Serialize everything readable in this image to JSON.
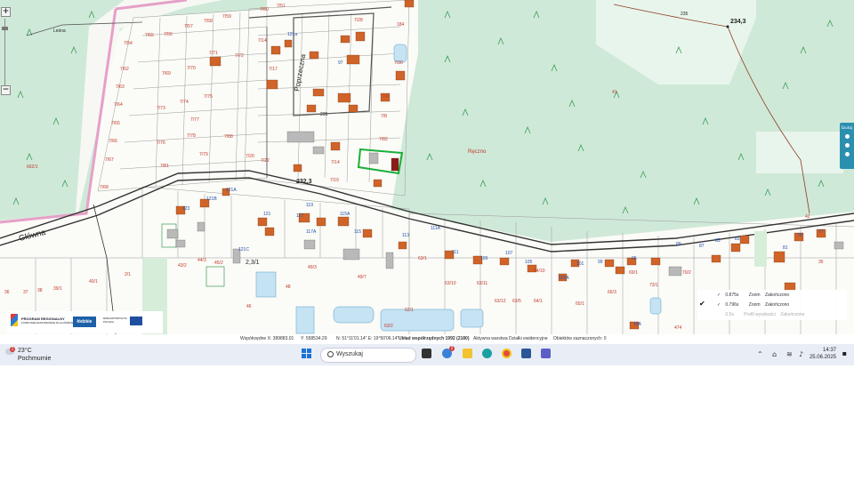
{
  "map": {
    "spot_heights": [
      "234,3",
      "232,3"
    ],
    "contour_labels": [
      "235",
      "235"
    ],
    "street_labels": [
      "Główna",
      "Poprzeczna",
      "Leśna",
      "Ręczno"
    ],
    "parcel_labels_red": [
      "7/50",
      "7/51",
      "7/52",
      "7/53",
      "7/54",
      "7/55",
      "7/56",
      "7/57",
      "7/58",
      "7/59",
      "7/60",
      "7/61",
      "7/62",
      "7/63",
      "7/64",
      "7/65",
      "7/66",
      "7/67",
      "7/68",
      "7/69",
      "7/70",
      "7/71",
      "7/72",
      "7/73",
      "7/74",
      "7/75",
      "7/76",
      "7/77",
      "7/78",
      "7/79",
      "7/80",
      "7/81",
      "7/82",
      "7/83",
      "7/84",
      "7/85",
      "7/86",
      "7/87",
      "7/88",
      "7/89",
      "7/90",
      "7/91",
      "7/92",
      "7/93",
      "7/14",
      "7/16",
      "7/17",
      "7/18",
      "7/19",
      "7/20",
      "7/22",
      "7/23",
      "7/24",
      "7/25",
      "7/26",
      "7/27",
      "7/28",
      "7/30",
      "7/31",
      "7/33",
      "7/34",
      "7/40",
      "7/44",
      "7/46",
      "7/48",
      "7/6",
      "7/8",
      "184",
      "638/1",
      "662/1",
      "41",
      "42",
      "43/2",
      "44/3",
      "45/2",
      "46",
      "48",
      "49/3",
      "49/7",
      "62/1",
      "63/1",
      "63/2",
      "63/10",
      "63/11",
      "63/12",
      "63/5",
      "64/1",
      "64/10",
      "65/1",
      "66/3",
      "69/1",
      "70/2",
      "73/1",
      "474",
      "35",
      "36",
      "37",
      "38",
      "39/1",
      "40/1",
      "2/1"
    ],
    "parcel_labels_blue": [
      "121A",
      "121B",
      "121C",
      "121",
      "123",
      "119",
      "117A",
      "117",
      "115A",
      "115",
      "113",
      "111",
      "109",
      "107",
      "105",
      "103",
      "101",
      "101A",
      "99",
      "97",
      "95",
      "93",
      "91",
      "89",
      "87",
      "85",
      "83",
      "81",
      "79",
      "77",
      "75",
      "73",
      "71",
      "69",
      "67",
      "65",
      "19A",
      "111A",
      "121a"
    ]
  },
  "controls": {
    "zoom_in": "+",
    "zoom_out": "−",
    "side_panel_title": "Szukaj"
  },
  "scale_text": "2,3/1",
  "status": {
    "coords_x": "Współrzędne X: 389883.01",
    "coords_y": "Y: 558534.29",
    "geo": "N: 51°11'01.14\" E: 19°50'06.14\"",
    "crs": "Układ współrzędnych 1992 (2180)",
    "layer": "Aktywna warstwa Działki ewidencyjne",
    "selected": "Obiektów zaznaczonych: 0"
  },
  "layers": [
    {
      "check": "✓",
      "time": "0.875s",
      "zoom": "Zoom",
      "state": "Zakończono",
      "dim": false
    },
    {
      "check": "✓",
      "time": "0.796s",
      "zoom": "Zoom",
      "state": "Zakończono",
      "dim": false
    },
    {
      "check": "",
      "time": "0.5s",
      "zoom": "Profil wysokości",
      "state": "Zakończono",
      "dim": true
    }
  ],
  "logos": {
    "program": "PROGRAM REGIONALNY",
    "program_sub": "FUNDUSZE EUROPEJSKIE DLA ŁÓDZKIEGO",
    "lodzkie": "łódzkie",
    "rzeczp": "RZECZPOSPOLITA POLSKA",
    "eu": "UNIA EUROPEJSKA"
  },
  "taskbar": {
    "weather_badge": "1",
    "temp": "23°C",
    "condition": "Pochmurnie",
    "search_placeholder": "Wyszukaj",
    "badge_count": "2",
    "time": "14:37",
    "date": "25.06.2025"
  },
  "colors": {
    "forest": "#cfe9d8",
    "forest_symbol": "#3a9d55",
    "building": "#d06428",
    "road": "#333333",
    "parcel_red": "#c0392b",
    "parcel_blue": "#1f4fb0",
    "selection": "#18b038",
    "boundary_pink": "#e6a0c8",
    "water": "#c5e3f3"
  }
}
